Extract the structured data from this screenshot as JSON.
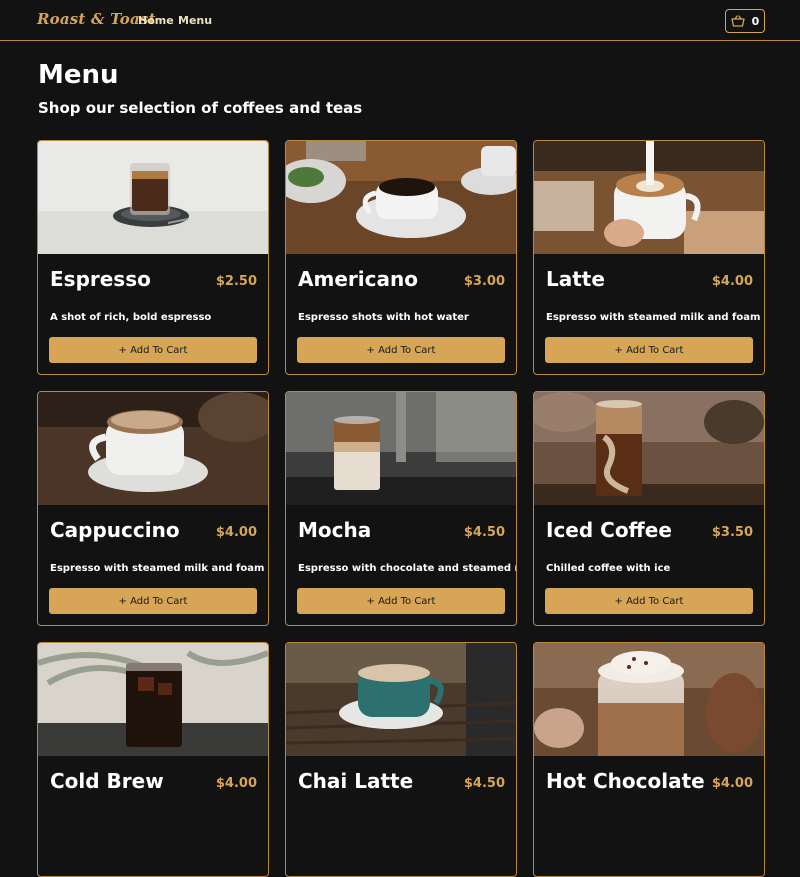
{
  "header": {
    "brand": "Roast & Toast",
    "nav": [
      "Home",
      "Menu"
    ],
    "cart_count": "0"
  },
  "page": {
    "title": "Menu",
    "subtitle": "Shop our selection of coffees and teas"
  },
  "products": [
    {
      "name": "Espresso",
      "price": "$2.50",
      "description": "A shot of rich, bold espresso",
      "button": "+ Add To Cart"
    },
    {
      "name": "Americano",
      "price": "$3.00",
      "description": "Espresso shots with hot water",
      "button": "+ Add To Cart"
    },
    {
      "name": "Latte",
      "price": "$4.00",
      "description": "Espresso with steamed milk and foam",
      "button": "+ Add To Cart"
    },
    {
      "name": "Cappuccino",
      "price": "$4.00",
      "description": "Espresso with steamed milk and foam",
      "button": "+ Add To Cart"
    },
    {
      "name": "Mocha",
      "price": "$4.50",
      "description": "Espresso with chocolate and steamed milk",
      "button": "+ Add To Cart"
    },
    {
      "name": "Iced Coffee",
      "price": "$3.50",
      "description": "Chilled coffee with ice",
      "button": "+ Add To Cart"
    },
    {
      "name": "Cold Brew",
      "price": "$4.00",
      "description": "",
      "button": ""
    },
    {
      "name": "Chai Latte",
      "price": "$4.50",
      "description": "",
      "button": ""
    },
    {
      "name": "Hot Chocolate",
      "price": "$4.00",
      "description": "",
      "button": ""
    }
  ],
  "icons": {
    "cart": "shopping-basket-icon"
  },
  "colors": {
    "background": "#121212",
    "accent": "#d6a556",
    "border": "#b8893f",
    "text": "#ffffff"
  }
}
